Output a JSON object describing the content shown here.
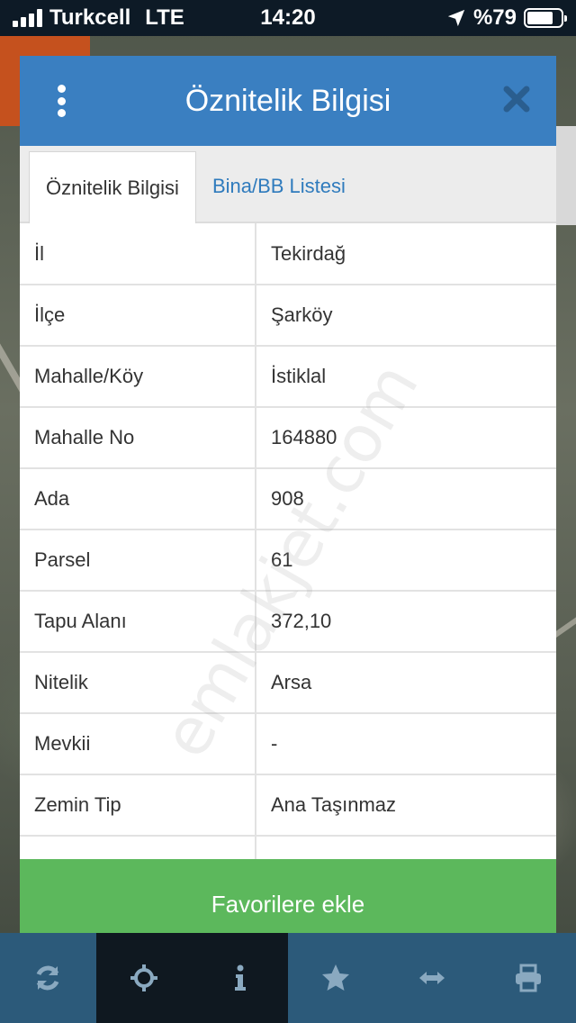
{
  "status_bar": {
    "carrier": "Turkcell",
    "network": "LTE",
    "time": "14:20",
    "battery_text": "%79",
    "battery_level": 0.79
  },
  "dialog": {
    "title": "Öznitelik Bilgisi",
    "tabs": [
      {
        "label": "Öznitelik Bilgisi",
        "active": true
      },
      {
        "label": "Bina/BB Listesi",
        "active": false
      }
    ],
    "rows": [
      {
        "key": "İl",
        "value": "Tekirdağ"
      },
      {
        "key": "İlçe",
        "value": "Şarköy"
      },
      {
        "key": "Mahalle/Köy",
        "value": "İstiklal"
      },
      {
        "key": "Mahalle No",
        "value": "164880"
      },
      {
        "key": "Ada",
        "value": "908"
      },
      {
        "key": "Parsel",
        "value": "61"
      },
      {
        "key": "Tapu Alanı",
        "value": "372,10"
      },
      {
        "key": "Nitelik",
        "value": "Arsa"
      },
      {
        "key": "Mevkii",
        "value": "-"
      },
      {
        "key": "Zemin Tip",
        "value": "Ana Taşınmaz"
      }
    ],
    "favorite_button": "Favorilere ekle",
    "watermark": "emlakjet.com"
  },
  "toolbar": {
    "icons": [
      "refresh-icon",
      "crosshair-icon",
      "info-icon",
      "star-icon",
      "measure-arrows-icon",
      "print-icon"
    ],
    "active_index": 2
  },
  "colors": {
    "header": "#3a7fc1",
    "favorite": "#5cb85c",
    "toolbar": "#2c5a7a",
    "toolbar_active": "#0f1820"
  }
}
